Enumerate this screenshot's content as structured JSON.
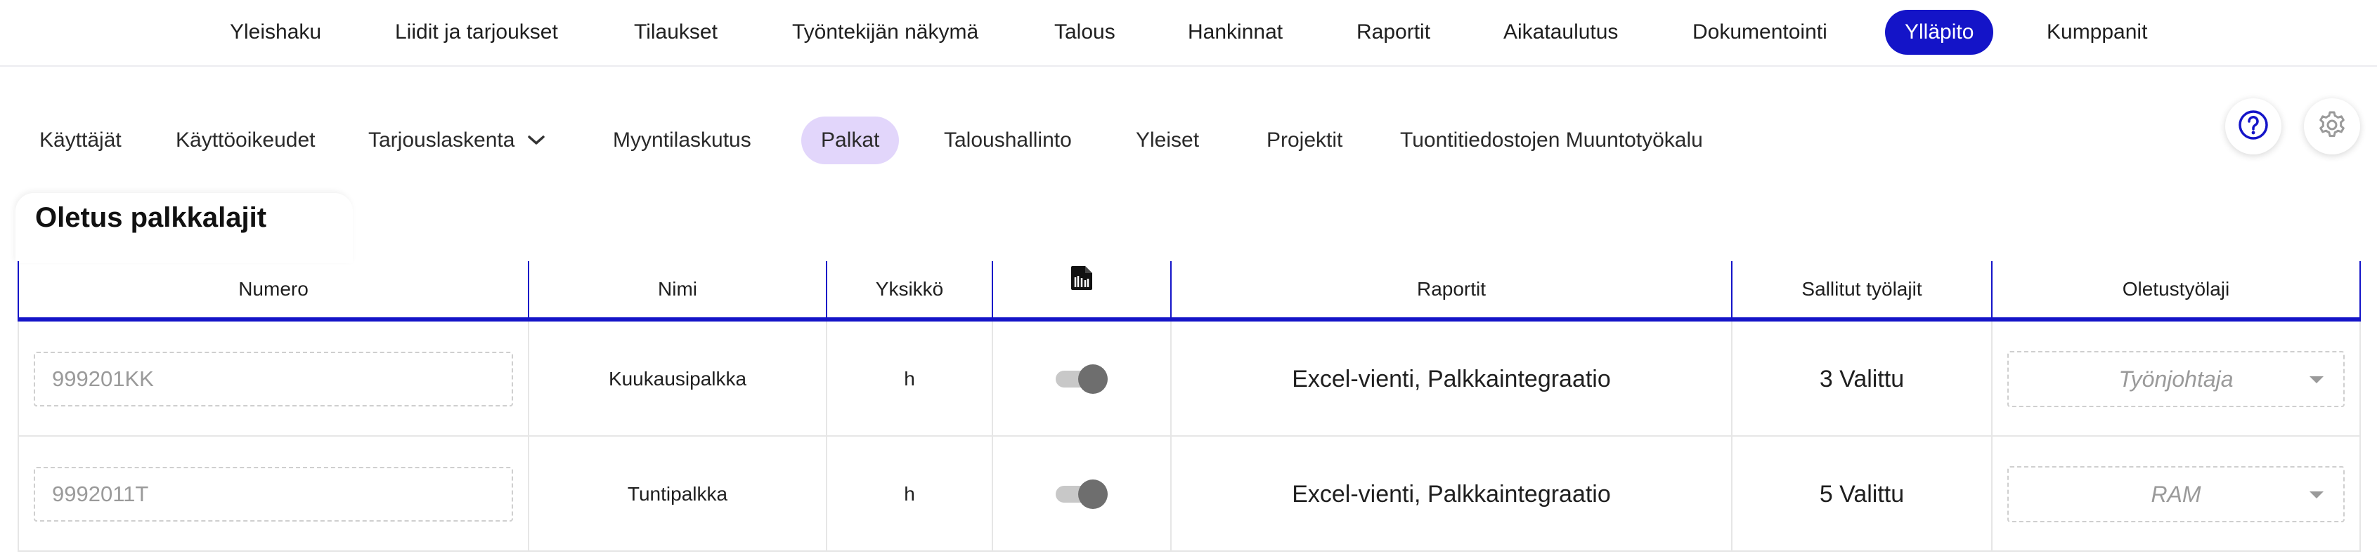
{
  "topnav": {
    "items": [
      {
        "label": "Yleishaku"
      },
      {
        "label": "Liidit ja tarjoukset"
      },
      {
        "label": "Tilaukset"
      },
      {
        "label": "Työntekijän näkymä"
      },
      {
        "label": "Talous"
      },
      {
        "label": "Hankinnat"
      },
      {
        "label": "Raportit"
      },
      {
        "label": "Aikataulutus"
      },
      {
        "label": "Dokumentointi"
      },
      {
        "label": "Ylläpito",
        "active": true
      },
      {
        "label": "Kumppanit"
      }
    ]
  },
  "subnav": {
    "items": [
      {
        "label": "Käyttäjät"
      },
      {
        "label": "Käyttöoikeudet"
      },
      {
        "label": "Tarjouslaskenta",
        "icon": "chevron-down-icon"
      },
      {
        "label": "Myyntilaskutus"
      },
      {
        "label": "Palkat",
        "active": true
      },
      {
        "label": "Taloushallinto"
      },
      {
        "label": "Yleiset"
      },
      {
        "label": "Projektit"
      },
      {
        "label": "Tuontitiedostojen Muuntotyökalu"
      }
    ],
    "help_icon": "help-circle-icon",
    "settings_icon": "gear-icon"
  },
  "section": {
    "title": "Oletus palkkalajit"
  },
  "table": {
    "headers": {
      "numero": "Numero",
      "nimi": "Nimi",
      "yksikko": "Yksikkö",
      "doc_icon": "document-icon",
      "raportit": "Raportit",
      "sallitut": "Sallitut työlajit",
      "oletus": "Oletustyölaji"
    },
    "rows": [
      {
        "numero_placeholder": "999201KK",
        "nimi": "Kuukausipalkka",
        "yksikko": "h",
        "toggle_on": true,
        "raportit": "Excel-vienti, Palkkaintegraatio",
        "sallitut": "3 Valittu",
        "oletus": "Työnjohtaja"
      },
      {
        "numero_placeholder": "9992011T",
        "nimi": "Tuntipalkka",
        "yksikko": "h",
        "toggle_on": true,
        "raportit": "Excel-vienti, Palkkaintegraatio",
        "sallitut": "5 Valittu",
        "oletus": "RAM"
      }
    ]
  },
  "colors": {
    "primary": "#1414c8",
    "active_subtab": "#e2d6fb"
  }
}
